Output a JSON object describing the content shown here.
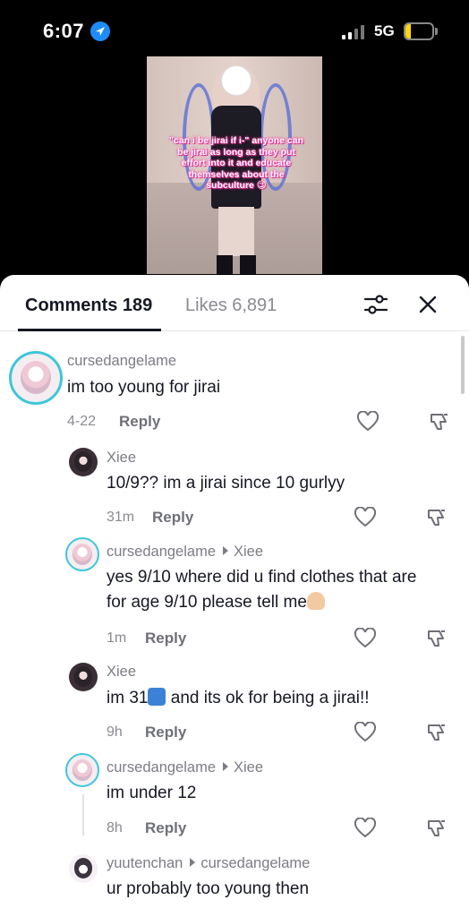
{
  "status_bar": {
    "time": "6:07",
    "network": "5G",
    "battery": "20",
    "battery_level": 0.2
  },
  "video": {
    "caption": "\"can i be jirai if i-\" anyone can be jirai as long as they put effort into it and educate themselves about the subculture 😉"
  },
  "sheet": {
    "tab_comments": "Comments 189",
    "tab_likes": "Likes 6,891",
    "filter_icon": "sliders-icon",
    "close_icon": "close-icon"
  },
  "comments": [
    {
      "user": "cursedangelame",
      "reply_to": "",
      "text": "im too young for jirai",
      "time": "4-22",
      "reply_label": "Reply"
    },
    {
      "user": "Xiee",
      "reply_to": "",
      "text": "10/9?? im a jirai since 10 gurlyy",
      "time": "31m",
      "reply_label": "Reply"
    },
    {
      "user": "cursedangelame",
      "reply_to": "Xiee",
      "text_line1": "yes 9/10 where did u find clothes that are",
      "text_line2": "for age 9/10 please tell me",
      "time": "1m",
      "reply_label": "Reply"
    },
    {
      "user": "Xiee",
      "reply_to": "",
      "text_pre": "im 31",
      "text_post": " and its ok for being a jirai!!",
      "time": "9h",
      "reply_label": "Reply"
    },
    {
      "user": "cursedangelame",
      "reply_to": "Xiee",
      "text": "im under 12",
      "time": "8h",
      "reply_label": "Reply"
    },
    {
      "user": "yuutenchan",
      "reply_to": "cursedangelame",
      "text": "ur probably too young then"
    }
  ],
  "colors": {
    "accent_ring": "#3fc6d9",
    "text_primary": "#161823",
    "text_secondary": "#8a8b91"
  }
}
